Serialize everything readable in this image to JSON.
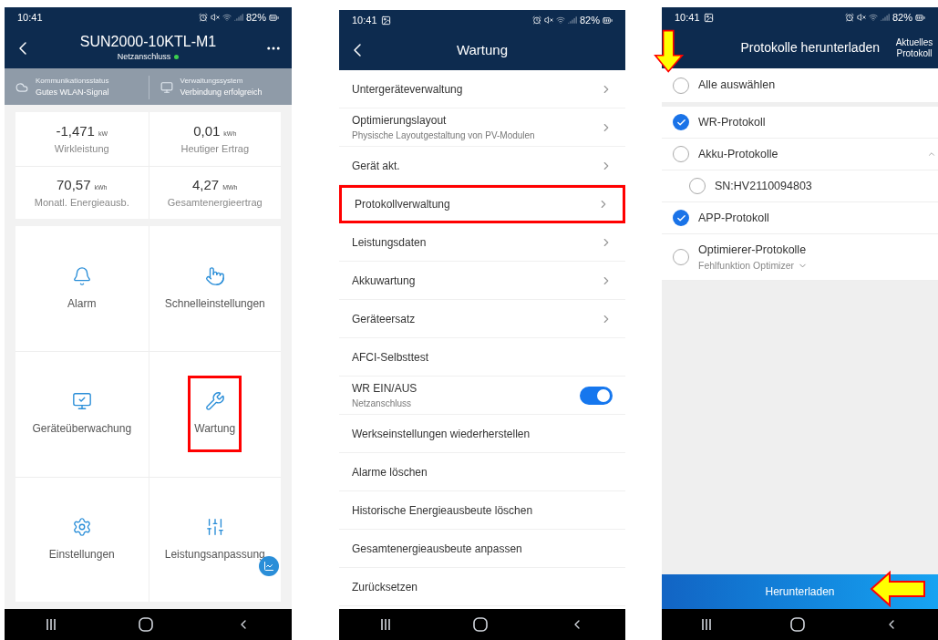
{
  "screens": [
    {
      "kind": "device",
      "status_bar": {
        "time": "10:41",
        "battery": "82%",
        "image_notification": false
      },
      "header": {
        "title": "SUN2000-10KTL-M1",
        "subtitle": "Netzanschluss",
        "online": true
      },
      "status_band": [
        {
          "label": "Kommunikationsstatus",
          "value": "Gutes WLAN-Signal"
        },
        {
          "label": "Verwaltungssystem",
          "value": "Verbindung erfolgreich"
        }
      ],
      "metrics": [
        {
          "value": "-1,471",
          "unit": "kW",
          "label": "Wirkleistung"
        },
        {
          "value": "0,01",
          "unit": "kWh",
          "label": "Heutiger Ertrag"
        },
        {
          "value": "70,57",
          "unit": "kWh",
          "label": "Monatl. Energieausb."
        },
        {
          "value": "4,27",
          "unit": "MWh",
          "label": "Gesamtenergieertrag"
        }
      ],
      "tiles": [
        {
          "label": "Alarm",
          "highlighted": false
        },
        {
          "label": "Schnelleinstellungen",
          "highlighted": false
        },
        {
          "label": "Geräteüberwachung",
          "highlighted": false
        },
        {
          "label": "Wartung",
          "highlighted": true
        },
        {
          "label": "Einstellungen",
          "highlighted": false
        },
        {
          "label": "Leistungsanpassung",
          "highlighted": false
        }
      ]
    },
    {
      "kind": "menu",
      "status_bar": {
        "time": "10:41",
        "battery": "82%",
        "image_notification": true
      },
      "header": {
        "title": "Wartung"
      },
      "items": [
        {
          "kind": "link",
          "label": "Untergeräteverwaltung",
          "highlighted": false
        },
        {
          "kind": "link",
          "label": "Optimierungslayout",
          "subtitle": "Physische Layoutgestaltung von PV-Modulen",
          "highlighted": false
        },
        {
          "kind": "link",
          "label": "Gerät akt.",
          "highlighted": false
        },
        {
          "kind": "link",
          "label": "Protokollverwaltung",
          "highlighted": true
        },
        {
          "kind": "link",
          "label": "Leistungsdaten",
          "highlighted": false
        },
        {
          "kind": "link",
          "label": "Akkuwartung",
          "highlighted": false
        },
        {
          "kind": "link",
          "label": "Geräteersatz",
          "highlighted": false
        },
        {
          "kind": "plain",
          "label": "AFCI-Selbsttest",
          "highlighted": false
        },
        {
          "kind": "toggle",
          "label": "WR EIN/AUS",
          "subtitle": "Netzanschluss",
          "on": true,
          "highlighted": false
        },
        {
          "kind": "plain",
          "label": "Werkseinstellungen wiederherstellen",
          "highlighted": false
        },
        {
          "kind": "plain",
          "label": "Alarme löschen",
          "highlighted": false
        },
        {
          "kind": "plain",
          "label": "Historische Energieausbeute löschen",
          "highlighted": false
        },
        {
          "kind": "plain",
          "label": "Gesamtenergieausbeute anpassen",
          "highlighted": false
        },
        {
          "kind": "plain",
          "label": "Zurücksetzen",
          "highlighted": false
        }
      ]
    },
    {
      "kind": "download",
      "status_bar": {
        "time": "10:41",
        "battery": "82%",
        "image_notification": true
      },
      "header": {
        "title": "Protokolle herunterladen",
        "action": "Aktuelles Protokoll"
      },
      "select_all": {
        "label": "Alle auswählen",
        "checked": false,
        "arrow": true
      },
      "options": [
        {
          "label": "WR-Protokoll",
          "checked": true
        },
        {
          "label": "Akku-Protokolle",
          "checked": false,
          "expanded": true,
          "children": [
            {
              "label": "SN:HV2110094803",
              "checked": false
            }
          ]
        },
        {
          "label": "APP-Protokoll",
          "checked": true
        },
        {
          "label": "Optimierer-Protokolle",
          "checked": false,
          "subtitle": "Fehlfunktion Optimizer"
        }
      ],
      "button": {
        "label": "Herunterladen",
        "arrow": true
      }
    }
  ]
}
